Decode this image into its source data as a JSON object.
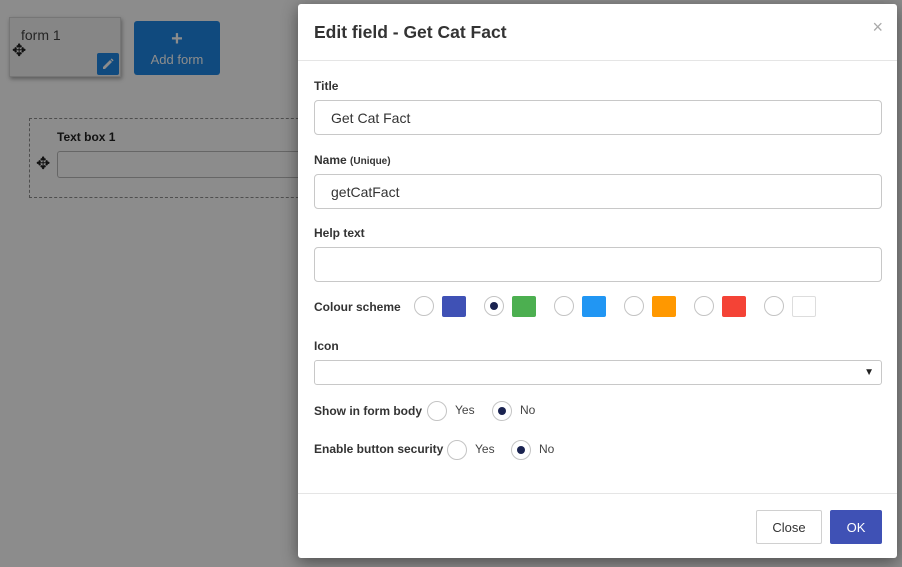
{
  "background": {
    "form_tab": {
      "label": "form 1",
      "move_icon": "✥",
      "edit_icon": "pencil-icon"
    },
    "add_form": {
      "plus": "+",
      "label": "Add form"
    },
    "textbox_field": {
      "label": "Text box 1",
      "move_icon": "✥"
    }
  },
  "modal": {
    "title": "Edit field - Get Cat Fact",
    "close_glyph": "×",
    "fields": {
      "title": {
        "label": "Title",
        "value": "Get Cat Fact"
      },
      "name": {
        "label": "Name",
        "hint": "(Unique)",
        "value": "getCatFact"
      },
      "help_text": {
        "label": "Help text",
        "value": ""
      },
      "colour_scheme": {
        "label": "Colour scheme",
        "selected_index": 1,
        "options": [
          {
            "color": "#3f51b5",
            "checked": false
          },
          {
            "color": "#4caf50",
            "checked": true
          },
          {
            "color": "#2196f3",
            "checked": false
          },
          {
            "color": "#ff9800",
            "checked": false
          },
          {
            "color": "#f44336",
            "checked": false
          },
          {
            "color": "#ffffff",
            "checked": false
          }
        ]
      },
      "icon": {
        "label": "Icon",
        "value": "",
        "arrow": "▼"
      },
      "show_in_form_body": {
        "label": "Show in form body",
        "yes": "Yes",
        "no": "No",
        "selected": "No"
      },
      "enable_button_security": {
        "label": "Enable button security",
        "yes": "Yes",
        "no": "No",
        "selected": "No"
      }
    },
    "footer": {
      "close_label": "Close",
      "ok_label": "OK"
    }
  },
  "colors": {
    "primary": "#3f51b5",
    "accent_blue": "#1e88e5",
    "radio_dot": "#1a2350"
  }
}
